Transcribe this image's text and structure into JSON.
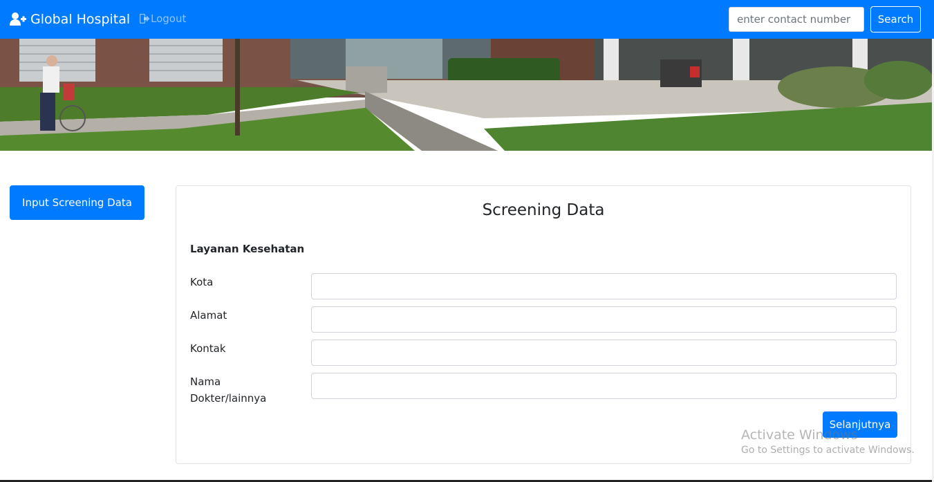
{
  "navbar": {
    "brand": "Global Hospital",
    "brand_icon": "user-plus-icon",
    "logout_label": "Logout",
    "logout_icon": "sign-out-icon",
    "search_placeholder": "enter contact number",
    "search_button": "Search",
    "accent_color": "#007bff"
  },
  "sidebar": {
    "button_label": "Input Screening Data"
  },
  "form": {
    "title": "Screening Data",
    "section": "Layanan Kesehatan",
    "fields": [
      {
        "label": "Kota",
        "value": ""
      },
      {
        "label": "Alamat",
        "value": ""
      },
      {
        "label": "Kontak",
        "value": ""
      },
      {
        "label": "Nama Dokter/lainnya",
        "value": ""
      }
    ],
    "submit_label": "Selanjutnya"
  },
  "watermark": {
    "title": "Activate Windows",
    "subtitle": "Go to Settings to activate Windows."
  }
}
